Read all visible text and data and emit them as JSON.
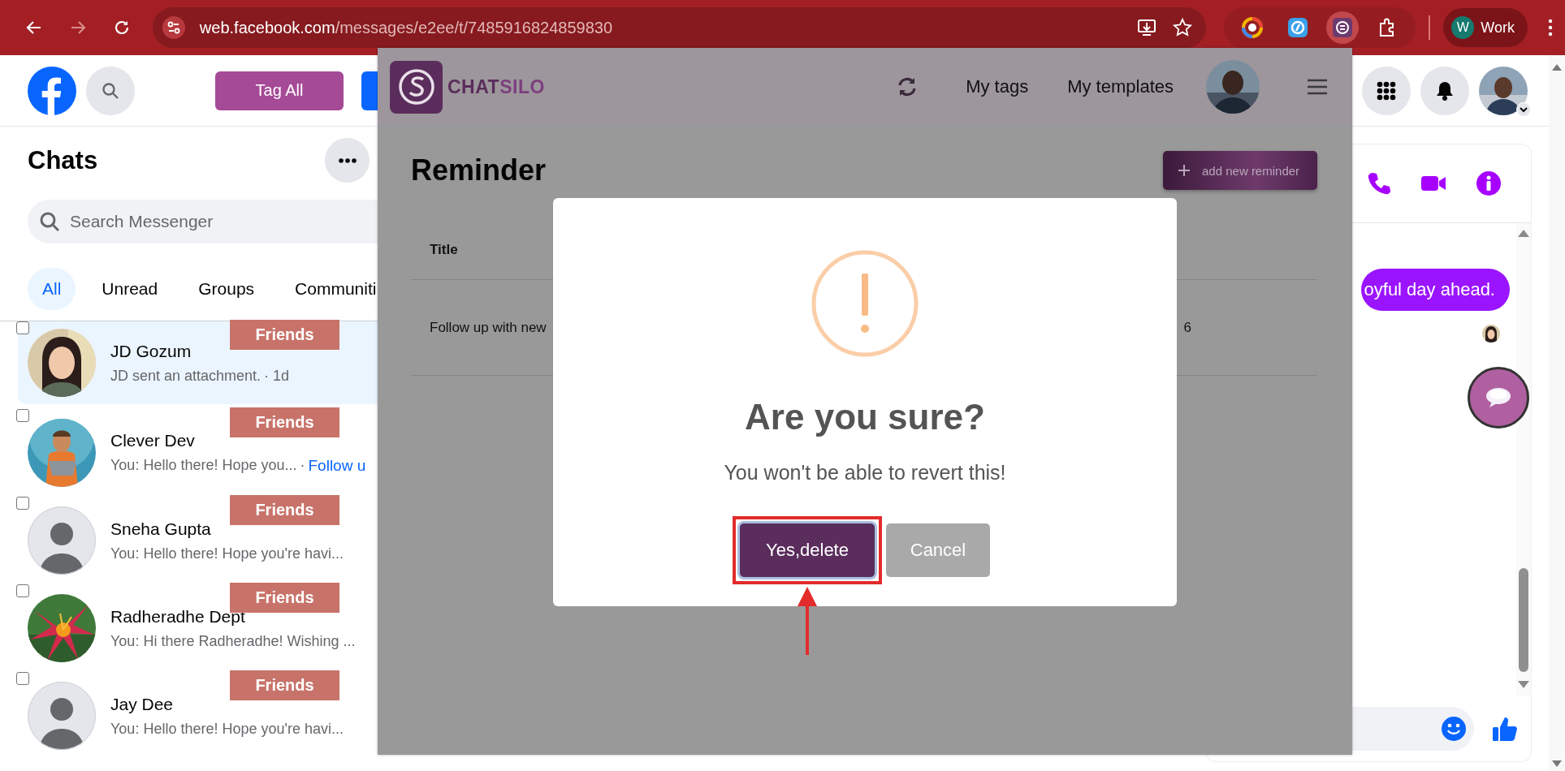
{
  "browser": {
    "url_host": "web.facebook.com",
    "url_path": "/messages/e2ee/t/7485916824859830",
    "profile_initial": "W",
    "profile": "Work"
  },
  "facebook": {
    "nav": {
      "tag_button": "Tag All"
    },
    "chats": {
      "title": "Chats",
      "search": {
        "placeholder": "Search Messenger"
      },
      "filters": [
        {
          "label": "All",
          "selected": true
        },
        {
          "label": "Unread",
          "selected": false
        },
        {
          "label": "Groups",
          "selected": false
        },
        {
          "label": "Communiti",
          "selected": false
        }
      ],
      "conversations": [
        {
          "name": "JD Gozum",
          "preview": "JD sent an attachment.",
          "meta": "· 1d",
          "tag": "Friends",
          "selected": true,
          "checked": false,
          "kind": "person"
        },
        {
          "name": "Clever Dev",
          "preview": "You: Hello there! Hope you...",
          "meta": "·",
          "link": "Follow u",
          "tag": "Friends",
          "selected": false,
          "checked": false,
          "kind": "character"
        },
        {
          "name": "Sneha Gupta",
          "preview": "You: Hello there! Hope you're havi...",
          "tag": "Friends",
          "selected": false,
          "checked": false,
          "kind": "default"
        },
        {
          "name": "Radheradhe Dept",
          "preview": "You: Hi there Radheradhe! Wishing ...",
          "tag": "Friends",
          "selected": false,
          "checked": false,
          "kind": "flower"
        },
        {
          "name": "Jay Dee",
          "preview": "You: Hello there! Hope you're havi...",
          "tag": "Friends",
          "selected": false,
          "checked": false,
          "kind": "default"
        }
      ]
    },
    "conversation": {
      "message": "oyful day ahead."
    }
  },
  "chatsilo": {
    "brand": {
      "part_1": "CHAT",
      "part_2": "SILO"
    },
    "nav": [
      "My tags",
      "My templates"
    ],
    "page_title": "Reminder",
    "add_button": "add new reminder",
    "table": {
      "columns": [
        "Title"
      ],
      "rows": [
        {
          "cells": [
            "Follow up with new",
            "6"
          ]
        }
      ]
    }
  },
  "dialog": {
    "title": "Are you sure?",
    "text": "You won't be able to revert this!",
    "buttons": [
      {
        "label": "Yes,delete",
        "kind": "confirm",
        "highlighted": true
      },
      {
        "label": "Cancel",
        "kind": "cancel",
        "highlighted": false
      }
    ]
  }
}
